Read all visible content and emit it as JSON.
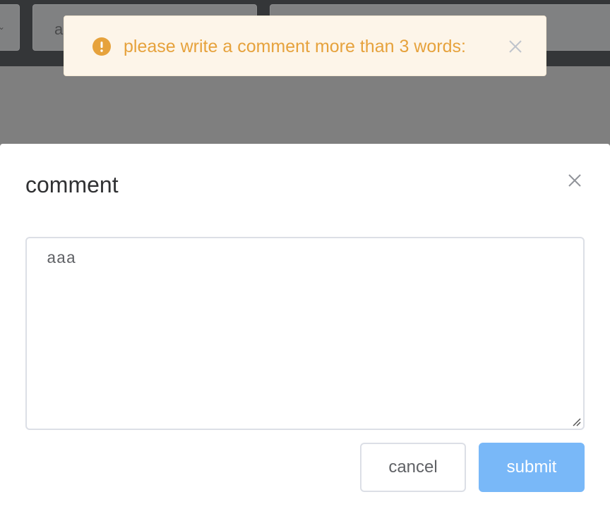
{
  "background": {
    "field_text": "a"
  },
  "toast": {
    "message": "please write a comment more than 3 words:",
    "icon": "warning-circle-icon",
    "color": "#e6a23c"
  },
  "dialog": {
    "title": "comment",
    "comment_value": "aaa",
    "cancel_label": "cancel",
    "submit_label": "submit",
    "submit_color": "#79b8f8"
  }
}
